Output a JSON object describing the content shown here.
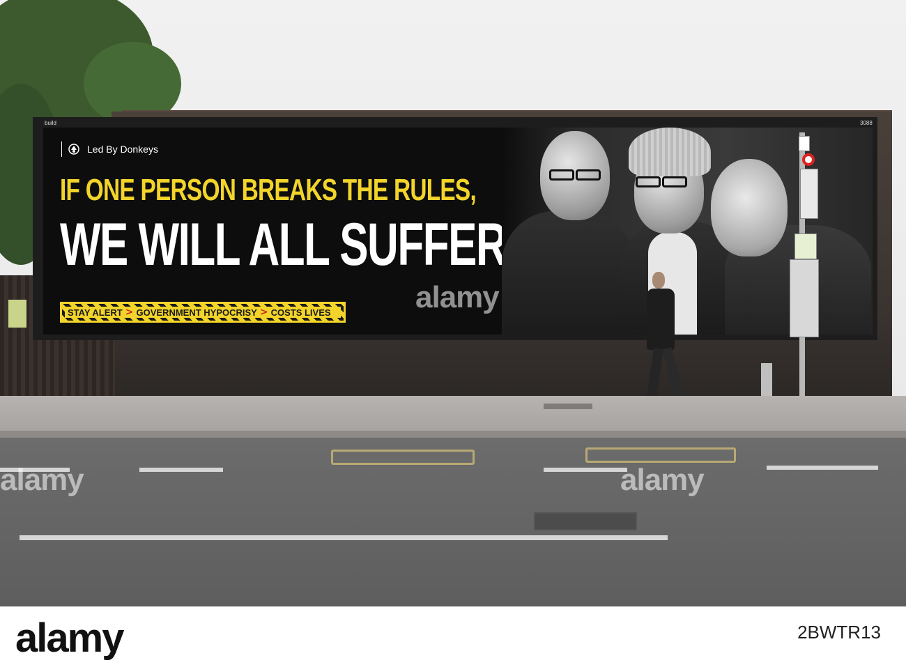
{
  "billboard": {
    "brand": "Led By Donkeys",
    "headline_line1": "IF ONE PERSON BREAKS THE RULES,",
    "headline_line2": "WE WILL ALL SUFFER",
    "tape": [
      "STAY ALERT",
      "GOVERNMENT HYPOCRISY",
      "COSTS LIVES"
    ],
    "tape_separator": ">",
    "operator": "build",
    "panel_number": "3088"
  },
  "watermark": "alamy",
  "footer": {
    "logo": "alamy",
    "image_id": "2BWTR13"
  },
  "colors": {
    "headline_yellow": "#f2d42a",
    "billboard_black": "#0d0d0d",
    "chevron_red": "#d12b1e"
  }
}
